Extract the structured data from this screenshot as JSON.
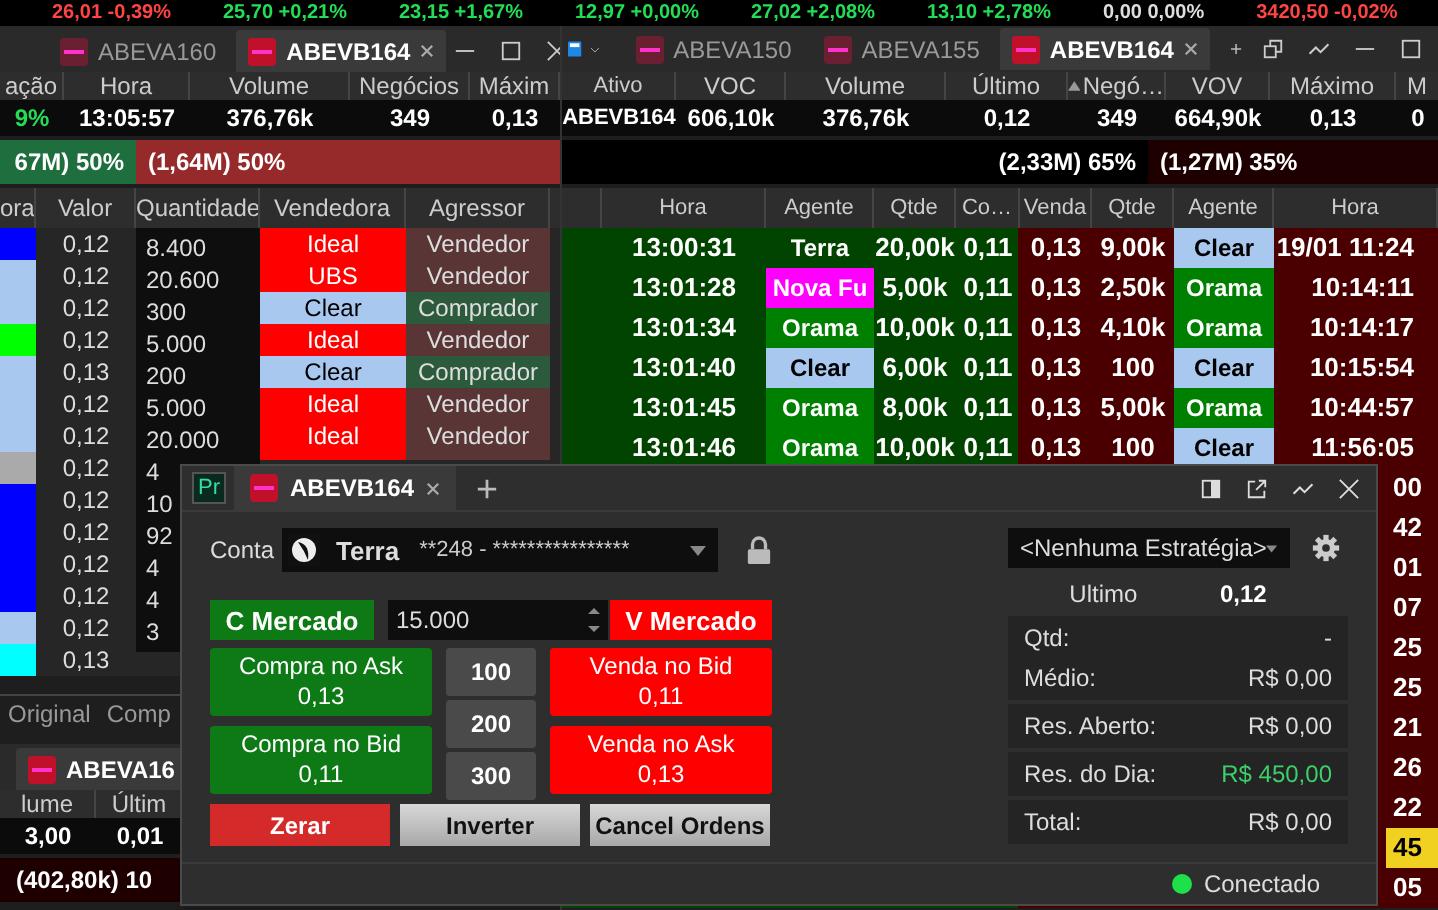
{
  "ticker": [
    {
      "text": "26,01 -0,39%",
      "color": "#ff4444"
    },
    {
      "text": "25,70 +0,21%",
      "color": "#22dd55"
    },
    {
      "text": "23,15 +1,67%",
      "color": "#22dd55"
    },
    {
      "text": "12,97 +0,00%",
      "color": "#22dd55"
    },
    {
      "text": "27,02 +2,08%",
      "color": "#22dd55"
    },
    {
      "text": "13,10 +2,78%",
      "color": "#22dd55"
    },
    {
      "text": "0,00 0,00%",
      "color": "#dddddd"
    },
    {
      "text": "3420,50 -0,02%",
      "color": "#ff4444"
    }
  ],
  "left_window": {
    "tabs": [
      {
        "label": "ABEVA160",
        "selected": false
      },
      {
        "label": "ABEVB164",
        "selected": true
      }
    ],
    "columns": [
      "ação",
      "Hora",
      "Volume",
      "Negócios",
      "Máxim"
    ],
    "values": [
      "9%",
      "13:05:57",
      "376,76k",
      "349",
      "0,13"
    ],
    "buy_pressure": "67M) 50%",
    "sell_pressure": "(1,64M) 50%",
    "table_columns": [
      "ora",
      "Valor",
      "Quantidade",
      "Vendedora",
      "Agressor"
    ],
    "rows": [
      {
        "color": "#0000ff",
        "price": "0,12",
        "qty": "8.400",
        "seller": {
          "text": "Ideal",
          "color": "#ff0000"
        },
        "aggressor": {
          "text": "Vendedor",
          "kind": "seller"
        }
      },
      {
        "color": "#a8c8f0",
        "price": "0,12",
        "qty": "20.600",
        "seller": {
          "text": "UBS",
          "color": "#ff0000"
        },
        "aggressor": {
          "text": "Vendedor",
          "kind": "seller"
        }
      },
      {
        "color": "#a8c8f0",
        "price": "0,12",
        "qty": "300",
        "seller": {
          "text": "Clear",
          "color": "#a8c8f0"
        },
        "aggressor": {
          "text": "Comprador",
          "kind": "buyer"
        }
      },
      {
        "color": "#00ff00",
        "price": "0,12",
        "qty": "5.000",
        "seller": {
          "text": "Ideal",
          "color": "#ff0000"
        },
        "aggressor": {
          "text": "Vendedor",
          "kind": "seller"
        }
      },
      {
        "color": "#a8c8f0",
        "price": "0,13",
        "qty": "200",
        "seller": {
          "text": "Clear",
          "color": "#a8c8f0"
        },
        "aggressor": {
          "text": "Comprador",
          "kind": "buyer"
        }
      },
      {
        "color": "#a8c8f0",
        "price": "0,12",
        "qty": "5.000",
        "seller": {
          "text": "Ideal",
          "color": "#ff0000"
        },
        "aggressor": {
          "text": "Vendedor",
          "kind": "seller"
        }
      },
      {
        "color": "#a8c8f0",
        "price": "0,12",
        "qty": "20.000",
        "seller": {
          "text": "Ideal",
          "color": "#ff0000"
        },
        "aggressor": {
          "text": "Vendedor",
          "kind": "seller"
        }
      },
      {
        "color": "#aaaaaa",
        "price": "0,12",
        "qty": "4"
      },
      {
        "color": "#0000ff",
        "price": "0,12",
        "qty": "10"
      },
      {
        "color": "#0000ff",
        "price": "0,12",
        "qty": "92"
      },
      {
        "color": "#0000ff",
        "price": "0,12",
        "qty": "4"
      },
      {
        "color": "#0000ff",
        "price": "0,12",
        "qty": "4"
      },
      {
        "color": "#a8c8f0",
        "price": "0,12",
        "qty": "3"
      },
      {
        "color": "#00ffff",
        "price": "0,13"
      }
    ]
  },
  "right_window": {
    "tabs": [
      {
        "label": "ABEVA150",
        "selected": false
      },
      {
        "label": "ABEVA155",
        "selected": false
      },
      {
        "label": "ABEVB164",
        "selected": true
      }
    ],
    "columns": [
      "Ativo",
      "VOC",
      "Volume",
      "Último",
      "Negó…",
      "VOV",
      "Máximo",
      "M"
    ],
    "values": [
      "ABEVB164",
      "606,10k",
      "376,76k",
      "0,12",
      "349",
      "664,90k",
      "0,13",
      "0"
    ],
    "buy_pressure": "(2,33M) 65%",
    "sell_pressure": "(1,27M) 35%",
    "table_columns": [
      "Hora",
      "Agente",
      "Qtde",
      "Co…",
      "Venda",
      "Qtde",
      "Agente",
      "Hora"
    ],
    "rows": [
      {
        "buy_time": "13:00:31",
        "buy_agent": {
          "text": "Terra",
          "color": "#004400"
        },
        "buy_qty": "20,00k",
        "buy_price": "0,11",
        "sell_price": "0,13",
        "sell_qty": "9,00k",
        "sell_agent": {
          "text": "Clear",
          "color": "#a8c8f0"
        },
        "sell_time": "19/01 11:24",
        "highlighted": false
      },
      {
        "buy_time": "13:01:28",
        "buy_agent": {
          "text": "Nova Fu",
          "color": "#ff00ff"
        },
        "buy_qty": "5,00k",
        "buy_price": "0,11",
        "sell_price": "0,13",
        "sell_qty": "2,50k",
        "sell_agent": {
          "text": "Orama",
          "color": "#008000"
        },
        "sell_time": "10:14:11",
        "highlighted": false
      },
      {
        "buy_time": "13:01:34",
        "buy_agent": {
          "text": "Orama",
          "color": "#008000"
        },
        "buy_qty": "10,00k",
        "buy_price": "0,11",
        "sell_price": "0,13",
        "sell_qty": "4,10k",
        "sell_agent": {
          "text": "Orama",
          "color": "#008000"
        },
        "sell_time": "10:14:17",
        "highlighted": false
      },
      {
        "buy_time": "13:01:40",
        "buy_agent": {
          "text": "Clear",
          "color": "#a8c8f0"
        },
        "buy_qty": "6,00k",
        "buy_price": "0,11",
        "sell_price": "0,13",
        "sell_qty": "100",
        "sell_agent": {
          "text": "Clear",
          "color": "#a8c8f0"
        },
        "sell_time": "10:15:54",
        "highlighted": false
      },
      {
        "buy_time": "13:01:45",
        "buy_agent": {
          "text": "Orama",
          "color": "#008000"
        },
        "buy_qty": "8,00k",
        "buy_price": "0,11",
        "sell_price": "0,13",
        "sell_qty": "5,00k",
        "sell_agent": {
          "text": "Orama",
          "color": "#008000"
        },
        "sell_time": "10:44:57",
        "highlighted": false
      },
      {
        "buy_time": "13:01:46",
        "buy_agent": {
          "text": "Orama",
          "color": "#008000"
        },
        "buy_qty": "10,00k",
        "buy_price": "0,11",
        "sell_price": "0,13",
        "sell_qty": "100",
        "sell_agent": {
          "text": "Clear",
          "color": "#a8c8f0"
        },
        "sell_time": "11:56:05",
        "highlighted": false
      },
      {
        "sell_time": "00",
        "highlighted": false
      },
      {
        "sell_time": "42",
        "highlighted": false
      },
      {
        "sell_time": "01",
        "highlighted": false
      },
      {
        "sell_time": "07",
        "highlighted": false
      },
      {
        "sell_time": "25",
        "highlighted": false
      },
      {
        "sell_time": "25",
        "highlighted": false
      },
      {
        "sell_time": "21",
        "highlighted": false
      },
      {
        "sell_time": "26",
        "highlighted": false
      },
      {
        "sell_time": "22",
        "highlighted": false
      },
      {
        "sell_time": "45",
        "highlighted": true
      },
      {
        "sell_time": "05",
        "highlighted": false
      }
    ]
  },
  "bottom_window": {
    "views": [
      {
        "label": "Original",
        "selected": false
      },
      {
        "label": "Comp",
        "selected": false
      }
    ],
    "tab": "ABEVA16",
    "columns": [
      "lume",
      "Últim"
    ],
    "values": [
      "3,00",
      "0,01"
    ],
    "pressure": "(402,80k) 10"
  },
  "order_window": {
    "app_badge": "Pr",
    "tab": "ABEVB164",
    "account_label": "Conta",
    "broker": "Terra",
    "account": "**248 - ****************",
    "strategy": "<Nenhuma Estratégia>",
    "buy_market": "C Mercado",
    "quantity": "15.000",
    "sell_market": "V Mercado",
    "buy_buttons": [
      {
        "label": "Compra no Ask",
        "price": "0,13"
      },
      {
        "label": "Compra no Bid",
        "price": "0,11"
      }
    ],
    "quick_quantities": [
      "100",
      "200",
      "300"
    ],
    "sell_buttons": [
      {
        "label": "Venda no Bid",
        "price": "0,11"
      },
      {
        "label": "Venda no Ask",
        "price": "0,13"
      }
    ],
    "actions": [
      {
        "label": "Zerar",
        "kind": "danger"
      },
      {
        "label": "Inverter",
        "kind": "neutral"
      },
      {
        "label": "Cancel Ordens",
        "kind": "neutral"
      }
    ],
    "last_label": "Ultimo",
    "last_value": "0,12",
    "position": [
      {
        "rows": [
          {
            "label": "Qtd:",
            "value": "-",
            "kind": "plain"
          },
          {
            "label": "Médio:",
            "value": "R$ 0,00",
            "kind": "plain"
          }
        ]
      },
      {
        "rows": [
          {
            "label": "Res. Aberto:",
            "value": "R$ 0,00",
            "kind": "plain"
          }
        ]
      },
      {
        "rows": [
          {
            "label": "Res. do Dia:",
            "value": "R$ 450,00",
            "kind": "gain"
          }
        ]
      },
      {
        "rows": [
          {
            "label": "Total:",
            "value": "R$ 0,00",
            "kind": "plain"
          }
        ]
      }
    ],
    "status": "Conectado",
    "connected": true
  }
}
